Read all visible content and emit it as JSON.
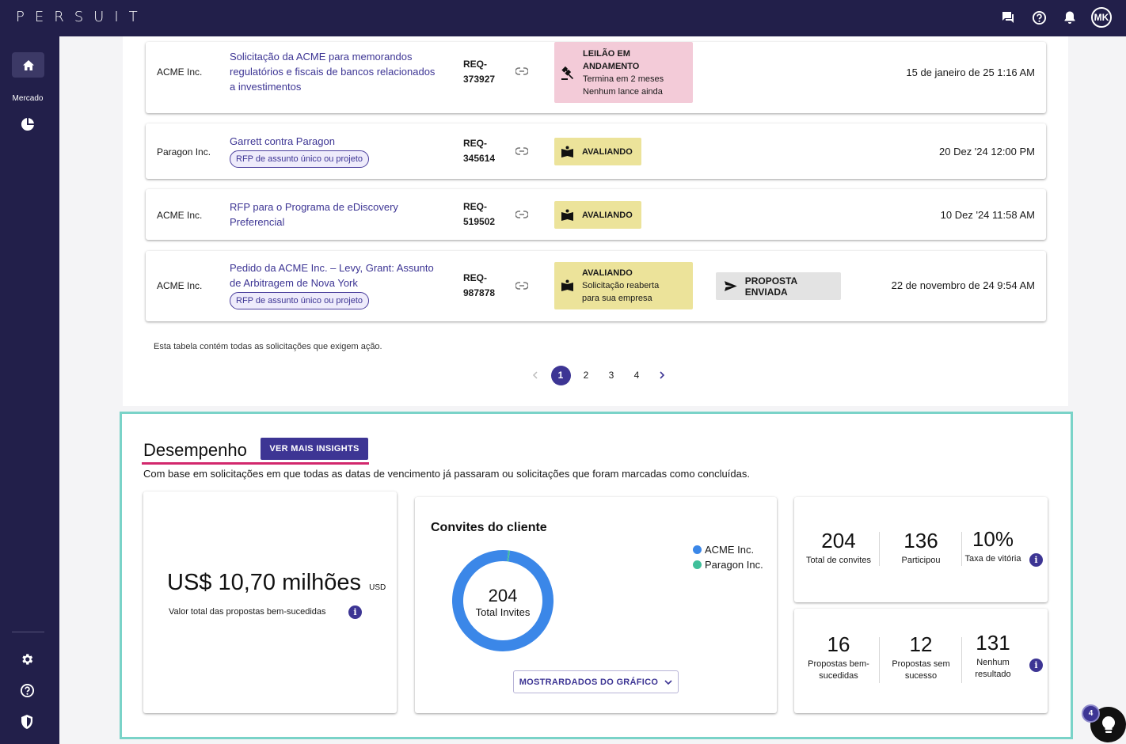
{
  "app": {
    "logo": "PERSUIT",
    "avatar_initials": "MK"
  },
  "sidebar": {
    "market_label": "Mercado"
  },
  "requests": [
    {
      "company": "ACME Inc.",
      "title": "Solicitação da ACME para memorandos regulatórios e fiscais de bancos relacionados a investimentos",
      "chip": "",
      "req_line1": "REQ-",
      "req_line2": "373927",
      "status_lines": [
        "LEILÃO EM",
        "ANDAMENTO",
        "Termina em 2 meses",
        "Nenhum lance ainda"
      ],
      "status_color": "#f3cbd8",
      "proposal": "",
      "date": "15 de janeiro de 25 1:16 AM"
    },
    {
      "company": "Paragon Inc.",
      "title": "Garrett contra Paragon",
      "chip": "RFP de assunto único ou projeto",
      "req_line1": "REQ-",
      "req_line2": "345614",
      "status_lines": [
        "AVALIANDO"
      ],
      "status_color": "#ece39a",
      "proposal": "",
      "date": "20 Dez '24 12:00 PM"
    },
    {
      "company": "ACME Inc.",
      "title": "RFP para o Programa de eDiscovery Preferencial",
      "chip": "",
      "req_line1": "REQ-",
      "req_line2": "519502",
      "status_lines": [
        "AVALIANDO"
      ],
      "status_color": "#ece39a",
      "proposal": "",
      "date": "10 Dez '24 11:58 AM"
    },
    {
      "company": "ACME Inc.",
      "title": "Pedido da ACME Inc. – Levy, Grant: Assunto de Arbitragem de Nova York",
      "chip": "RFP de assunto único ou projeto",
      "req_line1": "REQ-",
      "req_line2": "987878",
      "status_lines": [
        "AVALIANDO",
        "Solicitação reaberta",
        "para sua empresa"
      ],
      "status_color": "#ece39a",
      "proposal": "PROPOSTA ENVIADA",
      "date": "22 de novembro de 24 9:54 AM"
    }
  ],
  "table_note": "Esta tabela contém todas as solicitações que exigem ação.",
  "pagination": {
    "pages": [
      "1",
      "2",
      "3",
      "4"
    ],
    "current": "1"
  },
  "performance": {
    "title": "Desempenho",
    "insights_button": "VER MAIS INSIGHTS",
    "subtitle": "Com base em solicitações em que todas as datas de vencimento já passaram ou solicitações que foram marcadas como concluídas.",
    "total_value": "US$ 10,70 milhões",
    "total_value_unit": "USD",
    "total_value_label": "Valor total das propostas bem-sucedidas",
    "chart": {
      "title": "Convites do cliente",
      "center_number": "204",
      "center_label": "Total Invites",
      "button": "MOSTRARDADOS DO GRÁFICO"
    },
    "stats_top": [
      {
        "num": "204",
        "label": "Total de convites"
      },
      {
        "num": "136",
        "label": "Participou"
      },
      {
        "num": "10%",
        "label": "Taxa de vitória"
      }
    ],
    "stats_bottom": [
      {
        "num": "16",
        "label": "Propostas bem-sucedidas"
      },
      {
        "num": "12",
        "label": "Propostas sem sucesso"
      },
      {
        "num": "131",
        "label": "Nenhum resultado"
      }
    ]
  },
  "chart_data": {
    "type": "pie",
    "categories": [
      "ACME Inc.",
      "Paragon Inc."
    ],
    "values": [
      203,
      1
    ],
    "colors": [
      "#3b87e8",
      "#3fbf9a"
    ]
  },
  "help_badge": "4",
  "colors": {
    "brand": "#221f4a",
    "accent": "#3d3594",
    "highlight": "#d2286d",
    "section_border": "#7ad3c8"
  }
}
